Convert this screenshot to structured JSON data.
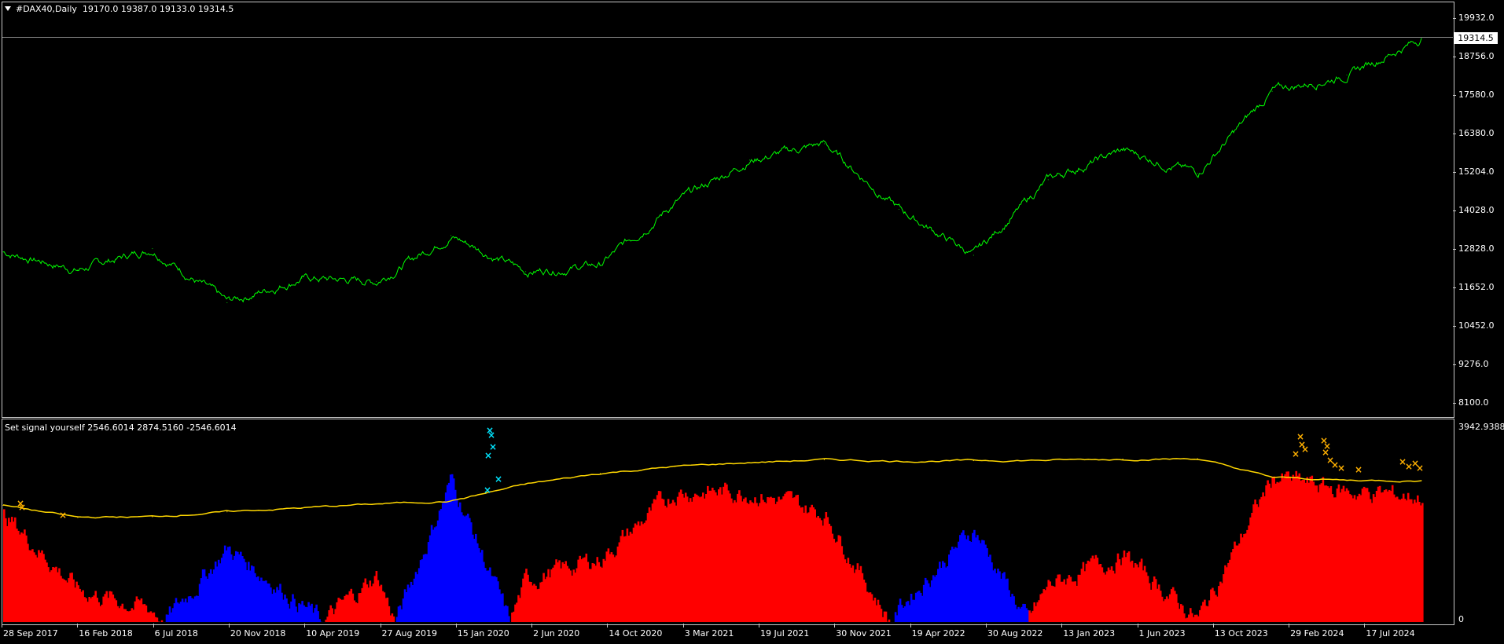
{
  "main_chart": {
    "title": "#DAX40,Daily",
    "ohlc": "19170.0 19387.0 19133.0 19314.5",
    "current_price": "19314.5",
    "y_labels": [
      "19932.0",
      "18756.0",
      "17580.0",
      "16380.0",
      "15204.0",
      "14028.0",
      "12828.0",
      "11652.0",
      "10452.0",
      "9276.0",
      "8100.0"
    ],
    "line_color": "#00ff00"
  },
  "indicator": {
    "title": "Set signal yourself",
    "values": "2546.6014 2874.5160 -2546.6014",
    "y_top_label": "3942.9388",
    "y_zero_label": "0",
    "colors": {
      "bull": "#0000ff",
      "bear": "#ff0000",
      "signal": "#ffd700",
      "cross_top": "#00e5ff",
      "cross_bottom": "#ffb000"
    }
  },
  "x_labels": [
    "28 Sep 2017",
    "16 Feb 2018",
    "6 Jul 2018",
    "20 Nov 2018",
    "10 Apr 2019",
    "27 Aug 2019",
    "15 Jan 2020",
    "2 Jun 2020",
    "14 Oct 2020",
    "3 Mar 2021",
    "19 Jul 2021",
    "30 Nov 2021",
    "19 Apr 2022",
    "30 Aug 2022",
    "13 Jan 2023",
    "1 Jun 2023",
    "13 Oct 2023",
    "29 Feb 2024",
    "17 Jul 2024"
  ],
  "chart_data": [
    {
      "type": "line",
      "series": [
        {
          "x": [
            "28 Sep 2017",
            "16 Feb 2018",
            "6 Jul 2018",
            "20 Nov 2018",
            "10 Apr 2019",
            "27 Aug 2019",
            "15 Jan 2020",
            "2 Jun 2020",
            "14 Oct 2020",
            "3 Mar 2021",
            "19 Jul 2021",
            "30 Nov 2021",
            "19 Apr 2022",
            "30 Aug 2022",
            "13 Jan 2023",
            "1 Jun 2023",
            "13 Oct 2023",
            "29 Feb 2024",
            "17 Jul 2024",
            "7 Oct 2024"
          ],
          "values": [
            12800,
            12250,
            12900,
            11250,
            12000,
            11900,
            13300,
            12200,
            12400,
            14300,
            15600,
            16100,
            14100,
            12700,
            15000,
            15900,
            15200,
            17700,
            18200,
            19314.5
          ]
        }
      ],
      "ylim": [
        8100,
        19932
      ]
    },
    {
      "type": "bar",
      "series": [
        {
          "x": [
            "28 Sep 2017",
            "16 Feb 2018",
            "6 Jul 2018",
            "20 Nov 2018",
            "10 Apr 2019",
            "27 Aug 2019",
            "15 Jan 2020",
            "2 Jun 2020",
            "14 Oct 2020",
            "3 Mar 2021",
            "19 Jul 2021",
            "30 Nov 2021",
            "19 Apr 2022",
            "30 Aug 2022",
            "13 Jan 2023",
            "1 Jun 2023",
            "13 Oct 2023",
            "29 Feb 2024",
            "17 Jul 2024",
            "7 Oct 2024"
          ],
          "values": [
            2200,
            650,
            250,
            -1500,
            -350,
            950,
            -2900,
            850,
            1300,
            2650,
            2650,
            2200,
            -300,
            -1900,
            750,
            1350,
            50,
            2950,
            2650,
            2546.6014
          ]
        }
      ],
      "signal_line": [
        2370,
        2125,
        2140,
        2240,
        2320,
        2400,
        2460,
        2800,
        3020,
        3160,
        3240,
        3300,
        3270,
        3280,
        3290,
        3310,
        3320,
        2940,
        2880,
        2874.516
      ],
      "ylim": [
        0,
        3942.9388
      ]
    }
  ]
}
